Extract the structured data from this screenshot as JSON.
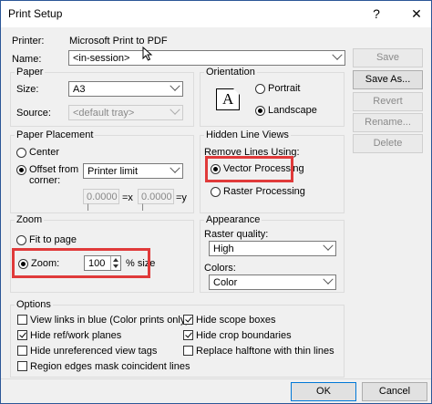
{
  "window": {
    "title": "Print Setup",
    "help_label": "?",
    "close_label": "✕"
  },
  "printer": {
    "label": "Printer:",
    "value": "Microsoft Print to PDF"
  },
  "name": {
    "label": "Name:",
    "value": "<in-session>"
  },
  "side_buttons": {
    "save": "Save",
    "save_as": "Save As...",
    "revert": "Revert",
    "rename": "Rename...",
    "delete": "Delete"
  },
  "paper": {
    "title": "Paper",
    "size_label": "Size:",
    "size_value": "A3",
    "source_label": "Source:",
    "source_value": "<default tray>"
  },
  "orientation": {
    "title": "Orientation",
    "portrait": "Portrait",
    "landscape": "Landscape",
    "selected": "landscape",
    "icon_letter": "A"
  },
  "paper_placement": {
    "title": "Paper Placement",
    "center": "Center",
    "offset_line1": "Offset from",
    "offset_line2": "corner:",
    "offset_value": "Printer limit",
    "x_value": "0.0000 I",
    "x_label": "=x",
    "y_value": "0.0000 I",
    "y_label": "=y",
    "selected": "offset"
  },
  "hidden_lines": {
    "title": "Hidden Line Views",
    "remove_label": "Remove Lines Using:",
    "vector": "Vector Processing",
    "raster": "Raster Processing",
    "selected": "vector"
  },
  "zoom": {
    "title": "Zoom",
    "fit": "Fit to page",
    "zoom_label": "Zoom:",
    "zoom_value": "100",
    "size_label": "% size",
    "selected": "zoom"
  },
  "appearance": {
    "title": "Appearance",
    "raster_label": "Raster quality:",
    "raster_value": "High",
    "colors_label": "Colors:",
    "colors_value": "Color"
  },
  "options": {
    "title": "Options",
    "left": [
      {
        "label": "View links in blue (Color prints only)",
        "checked": false
      },
      {
        "label": "Hide ref/work planes",
        "checked": true
      },
      {
        "label": "Hide unreferenced view tags",
        "checked": false
      },
      {
        "label": "Region edges mask coincident lines",
        "checked": false
      }
    ],
    "right": [
      {
        "label": "Hide scope boxes",
        "checked": true
      },
      {
        "label": "Hide crop boundaries",
        "checked": true
      },
      {
        "label": "Replace halftone with thin lines",
        "checked": false
      }
    ]
  },
  "footer": {
    "ok": "OK",
    "cancel": "Cancel"
  },
  "colors": {
    "highlight": "#e03a3a",
    "titlebar_border": "#2b5797"
  }
}
